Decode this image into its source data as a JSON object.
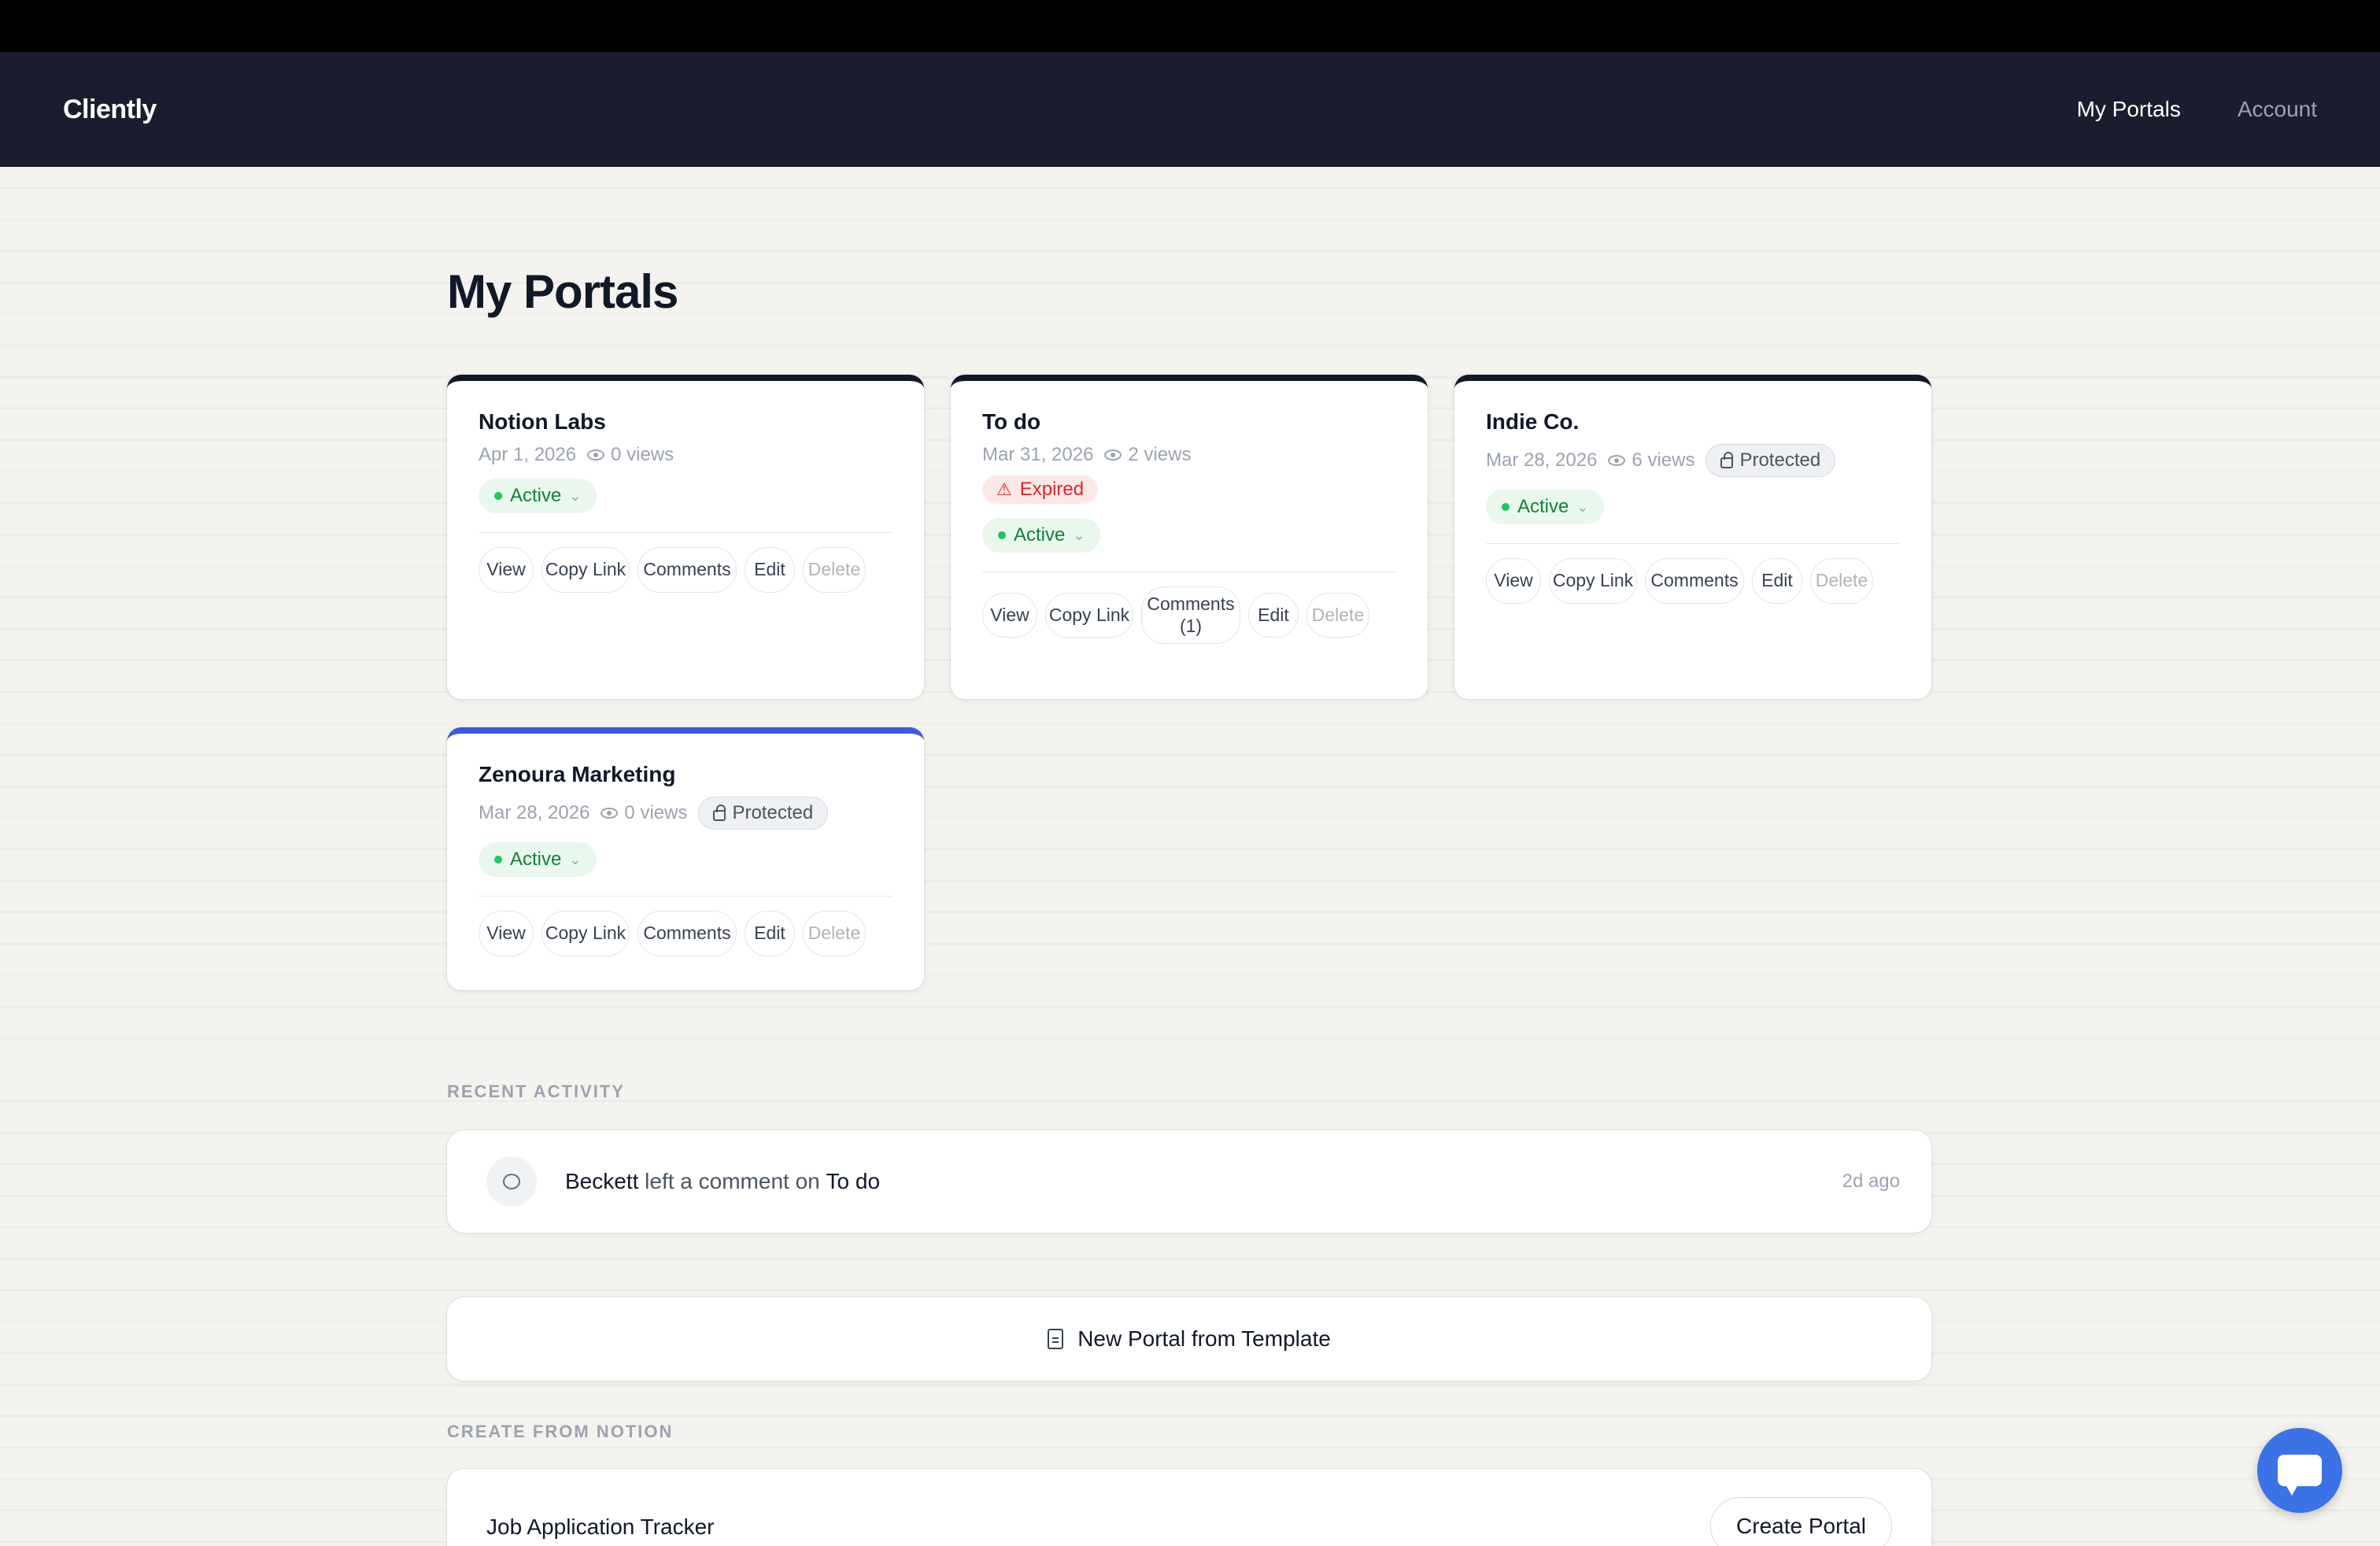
{
  "app": {
    "brand": "Cliently"
  },
  "nav": {
    "items": [
      {
        "label": "My Portals"
      },
      {
        "label": "Account"
      }
    ]
  },
  "page": {
    "title": "My Portals"
  },
  "portals": [
    {
      "title": "Notion Labs",
      "date": "Apr 1, 2026",
      "views": "0 views",
      "status": "Active",
      "actions": {
        "view": "View",
        "copy": "Copy Link",
        "comments": "Comments",
        "edit": "Edit",
        "delete": "Delete"
      }
    },
    {
      "title": "To do",
      "date": "Mar 31, 2026",
      "views": "2 views",
      "expired": "Expired",
      "status": "Active",
      "actions": {
        "view": "View",
        "copy": "Copy Link",
        "comments": "Comments (1)",
        "edit": "Edit",
        "delete": "Delete"
      }
    },
    {
      "title": "Indie Co.",
      "date": "Mar 28, 2026",
      "views": "6 views",
      "badge": "Protected",
      "status": "Active",
      "actions": {
        "view": "View",
        "copy": "Copy Link",
        "comments": "Comments",
        "edit": "Edit",
        "delete": "Delete"
      }
    },
    {
      "title": "Zenoura Marketing",
      "date": "Mar 28, 2026",
      "views": "0 views",
      "badge": "Protected",
      "status": "Active",
      "actions": {
        "view": "View",
        "copy": "Copy Link",
        "comments": "Comments",
        "edit": "Edit",
        "delete": "Delete"
      }
    }
  ],
  "recent_activity": {
    "label": "RECENT ACTIVITY",
    "items": [
      {
        "user": "Beckett",
        "action": "left a comment on",
        "target": "To do",
        "time": "2d ago"
      }
    ]
  },
  "template_button": {
    "label": "New Portal from Template"
  },
  "create_from_notion": {
    "label": "CREATE FROM NOTION",
    "items": [
      {
        "title": "Job Application Tracker",
        "button": "Create Portal"
      }
    ]
  },
  "colors": {
    "nav_bg": "#1b1c2e",
    "accent_blue": "#3b5bdb",
    "active_green": "#15803d",
    "expired_red": "#dc2626",
    "chat_blue": "#3b73e6"
  }
}
